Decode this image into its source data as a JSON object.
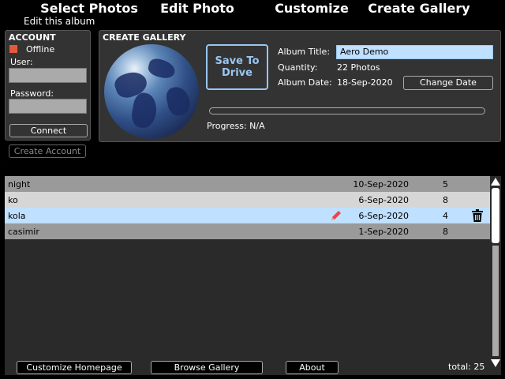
{
  "nav": {
    "tabs": [
      {
        "label": "Select Photos"
      },
      {
        "label": "Edit Photo"
      },
      {
        "label": "Customize"
      },
      {
        "label": "Create Gallery"
      }
    ],
    "subtitle": "Edit this album"
  },
  "account": {
    "title": "ACCOUNT",
    "status": "Offline",
    "status_color": "#e25a3c",
    "user_label": "User:",
    "user_value": "",
    "password_label": "Password:",
    "password_value": "",
    "connect_label": "Connect",
    "create_account_label": "Create Account"
  },
  "create_gallery": {
    "title": "CREATE GALLERY",
    "save_label_line1": "Save To",
    "save_label_line2": "Drive",
    "album_title_label": "Album Title:",
    "album_title_value": "Aero Demo",
    "quantity_label": "Quantity:",
    "quantity_value": "22 Photos",
    "album_date_label": "Album Date:",
    "album_date_value": "18-Sep-2020",
    "change_date_label": "Change Date",
    "progress_fraction": 0,
    "progress_text": "Progress: N/A"
  },
  "albums": {
    "rows": [
      {
        "name": "night",
        "date": "10-Sep-2020",
        "count": "5"
      },
      {
        "name": "ko",
        "date": "6-Sep-2020",
        "count": "8"
      },
      {
        "name": "kola",
        "date": "6-Sep-2020",
        "count": "4"
      },
      {
        "name": "casimir",
        "date": "1-Sep-2020",
        "count": "8"
      }
    ]
  },
  "footer": {
    "customize_homepage_label": "Customize Homepage",
    "browse_gallery_label": "Browse Gallery",
    "about_label": "About",
    "total_text": "total: 25"
  },
  "colors": {
    "accent": "#9ac6f2",
    "selected_row": "#bfe0ff",
    "edit_icon": "#e8454b"
  }
}
